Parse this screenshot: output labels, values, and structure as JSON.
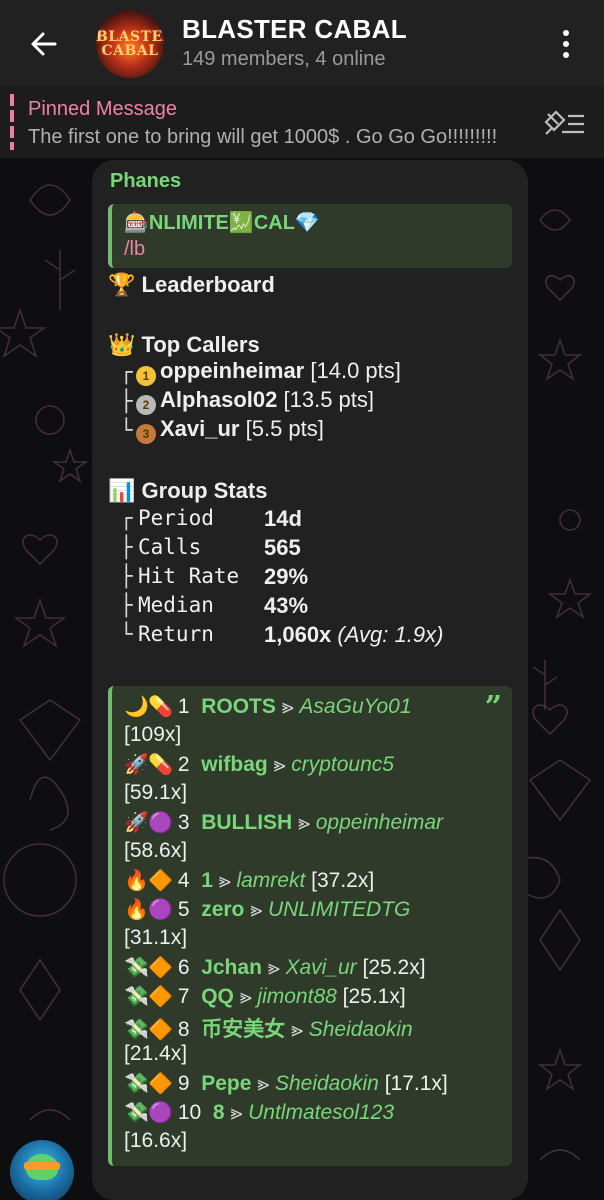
{
  "header": {
    "title": "BLASTER CABAL",
    "subtitle": "149 members, 4 online",
    "avatar_text_1": "BLASTER",
    "avatar_text_2": "CABAL"
  },
  "pinned": {
    "label": "Pinned Message",
    "text": "The first one to bring will get 1000$ . Go Go Go!!!!!!!!!"
  },
  "message": {
    "sender": "Phanes",
    "reply": {
      "title_prefix": "🎰",
      "title_text": "NLIMITE",
      "title_mid": "💹",
      "title_end": "CAL",
      "title_suffix": "💎",
      "text": "/lb"
    },
    "leaderboard_title": "Leaderboard",
    "leaderboard_emoji": "🏆",
    "top_callers_title": "Top Callers",
    "top_callers_emoji": "👑",
    "top_callers": [
      {
        "medal": "1",
        "name": "oppeinheimar",
        "pts": "[14.0 pts]",
        "color": "#f2c33a"
      },
      {
        "medal": "2",
        "name": "Alphasol02",
        "pts": "[13.5 pts]",
        "color": "#b8b8b8"
      },
      {
        "medal": "3",
        "name": "Xavi_ur",
        "pts": "[5.5 pts]",
        "color": "#c47a3a"
      }
    ],
    "group_stats_title": "Group Stats",
    "group_stats_emoji": "📊",
    "stats": [
      {
        "label": "Period",
        "value": "14d",
        "extra": ""
      },
      {
        "label": "Calls",
        "value": "565",
        "extra": ""
      },
      {
        "label": "Hit Rate",
        "value": "29%",
        "extra": ""
      },
      {
        "label": "Median",
        "value": "43%",
        "extra": ""
      },
      {
        "label": "Return",
        "value": "1,060x",
        "extra": "(Avg: 1.9x)"
      }
    ],
    "quote_mark": "”",
    "calls": [
      {
        "e1": "🌙",
        "e2": "💊",
        "num": "1",
        "token": "ROOTS",
        "arrow": "⪢",
        "user": "AsaGuYo01",
        "mult": "[109x]"
      },
      {
        "e1": "🚀",
        "e2": "💊",
        "num": "2",
        "token": "wifbag",
        "arrow": "⪢",
        "user": "cryptounc5",
        "mult": "[59.1x]"
      },
      {
        "e1": "🚀",
        "e2": "🟣",
        "num": "3",
        "token": "BULLISH",
        "arrow": "⪢",
        "user": "oppeinheimar",
        "mult": "[58.6x]"
      },
      {
        "e1": "🔥",
        "e2": "🔶",
        "num": "4",
        "token": "1",
        "arrow": "⪢",
        "user": "lamrekt",
        "mult": "[37.2x]"
      },
      {
        "e1": "🔥",
        "e2": "🟣",
        "num": "5",
        "token": "zero",
        "arrow": "⪢",
        "user": "UNLIMITEDTG",
        "mult": "[31.1x]"
      },
      {
        "e1": "💸",
        "e2": "🔶",
        "num": "6",
        "token": "Jchan",
        "arrow": "⪢",
        "user": "Xavi_ur",
        "mult": "[25.2x]"
      },
      {
        "e1": "💸",
        "e2": "🔶",
        "num": "7",
        "token": "QQ",
        "arrow": "⪢",
        "user": "jimont88",
        "mult": "[25.1x]"
      },
      {
        "e1": "💸",
        "e2": "🔶",
        "num": "8",
        "token": "币安美女",
        "arrow": "⪢",
        "user": "Sheidaokin",
        "mult": "[21.4x]"
      },
      {
        "e1": "💸",
        "e2": "🔶",
        "num": "9",
        "token": "Pepe",
        "arrow": "⪢",
        "user": "Sheidaokin",
        "mult": "[17.1x]"
      },
      {
        "e1": "💸",
        "e2": "🟣",
        "num": "10",
        "token": "8",
        "arrow": "⪢",
        "user": "Untlmatesol123",
        "mult": "[16.6x]"
      }
    ]
  },
  "colors": {
    "accent_green": "#79d67a",
    "pinned_pink": "#ef82aa",
    "bubble": "#212121",
    "quote_bg": "#2f3a2b"
  }
}
